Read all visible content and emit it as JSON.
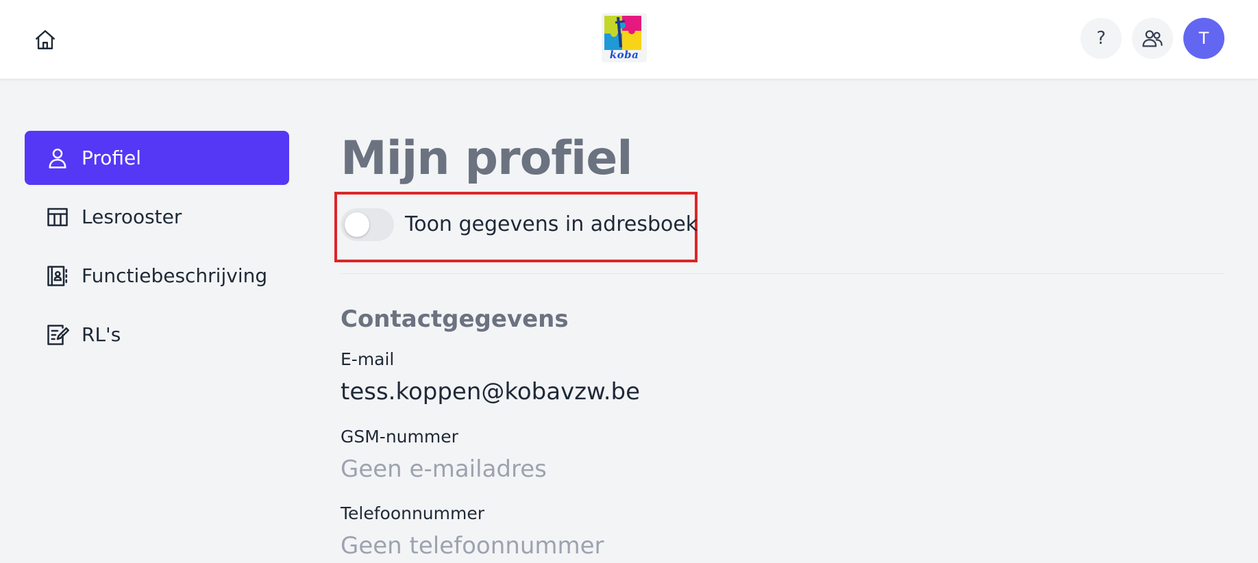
{
  "header": {
    "home_icon": "home-icon",
    "logo_text": "koba",
    "help_label": "?",
    "team_icon": "users-icon",
    "avatar_initial": "T",
    "colors": {
      "avatar": "#6366f1",
      "accent": "#5438f5"
    }
  },
  "sidebar": {
    "items": [
      {
        "label": "Profiel",
        "icon": "user-icon",
        "active": true
      },
      {
        "label": "Lesrooster",
        "icon": "table-icon",
        "active": false
      },
      {
        "label": "Functiebeschrijving",
        "icon": "contact-card-icon",
        "active": false
      },
      {
        "label": "RL's",
        "icon": "document-edit-icon",
        "active": false
      }
    ]
  },
  "main": {
    "title": "Mijn profiel",
    "toggle": {
      "label": "Toon gegevens in adresboek",
      "checked": false
    },
    "section_title": "Contactgegevens",
    "fields": [
      {
        "label": "E-mail",
        "value": "tess.koppen@kobavzw.be",
        "empty": false
      },
      {
        "label": "GSM-nummer",
        "value": "Geen e-mailadres",
        "empty": true
      },
      {
        "label": "Telefoonnummer",
        "value": "Geen telefoonnummer",
        "empty": true
      }
    ]
  }
}
